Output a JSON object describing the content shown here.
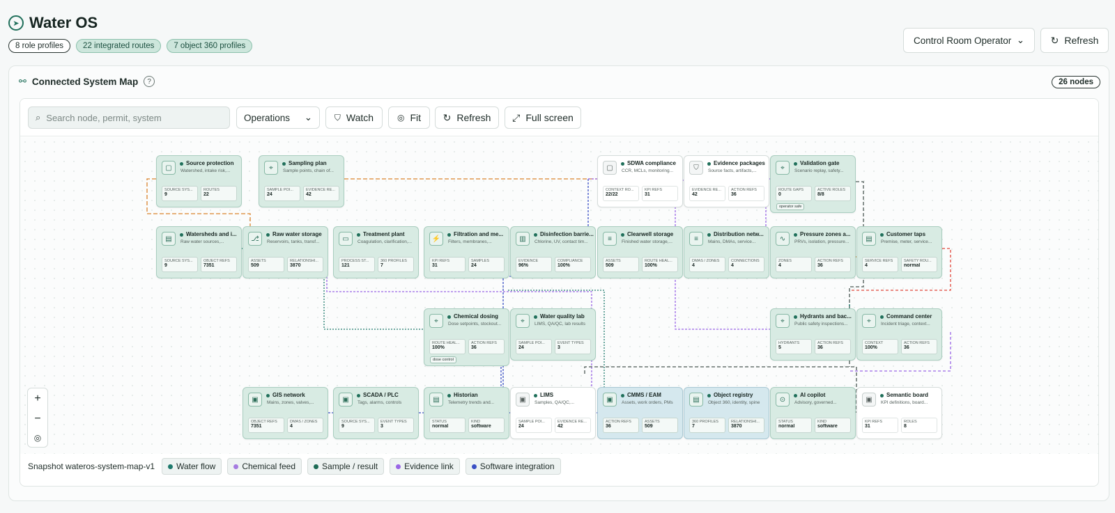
{
  "header": {
    "title": "Water OS",
    "badges": [
      "8 role profiles",
      "22 integrated routes",
      "7 object 360 profiles"
    ],
    "role_select": "Control Room Operator",
    "refresh_label": "Refresh"
  },
  "panel": {
    "title": "Connected System Map",
    "node_count": "26 nodes"
  },
  "toolbar": {
    "search_placeholder": "Search node, permit, system",
    "mode": "Operations",
    "watch": "Watch",
    "fit": "Fit",
    "refresh": "Refresh",
    "fullscreen": "Full screen"
  },
  "nodes": [
    {
      "title": "Source protection",
      "sub": "Watershed, intake risk,...",
      "s1l": "SOURCE SYS...",
      "s1v": "9",
      "s2l": "ROUTES",
      "s2v": "22"
    },
    {
      "title": "Sampling plan",
      "sub": "Sample points, chain of...",
      "s1l": "SAMPLE POI...",
      "s1v": "24",
      "s2l": "EVIDENCE RE...",
      "s2v": "42"
    },
    {
      "title": "SDWA compliance",
      "sub": "CCR, MCLs, monitoring...",
      "s1l": "CONTEXT RO...",
      "s1v": "22/22",
      "s2l": "KPI REFS",
      "s2v": "31"
    },
    {
      "title": "Evidence packages",
      "sub": "Source facts, artifacts,...",
      "s1l": "EVIDENCE RE...",
      "s1v": "42",
      "s2l": "ACTION REFS",
      "s2v": "36"
    },
    {
      "title": "Validation gate",
      "sub": "Scenario replay, safety...",
      "s1l": "ROUTE GAPS",
      "s1v": "0",
      "s2l": "ACTIVE ROLES",
      "s2v": "8/8",
      "chip": "operator safe"
    },
    {
      "title": "Watersheds and i...",
      "sub": "Raw water sources,...",
      "s1l": "SOURCE SYS...",
      "s1v": "9",
      "s2l": "OBJECT REFS",
      "s2v": "7351"
    },
    {
      "title": "Raw water storage",
      "sub": "Reservoirs, tanks, transf...",
      "s1l": "ASSETS",
      "s1v": "509",
      "s2l": "RELATIONSHI...",
      "s2v": "3870"
    },
    {
      "title": "Treatment plant",
      "sub": "Coagulation, clarification,...",
      "s1l": "PROCESS ST...",
      "s1v": "121",
      "s2l": "360 PROFILES",
      "s2v": "7"
    },
    {
      "title": "Filtration and me...",
      "sub": "Filters, membranes,...",
      "s1l": "KPI REFS",
      "s1v": "31",
      "s2l": "SAMPLES",
      "s2v": "24"
    },
    {
      "title": "Disinfection barrie...",
      "sub": "Chlorine, UV, contact tim...",
      "s1l": "EVIDENCE",
      "s1v": "96%",
      "s2l": "COMPLIANCE",
      "s2v": "100%"
    },
    {
      "title": "Clearwell storage",
      "sub": "Finished water storage,...",
      "s1l": "ASSETS",
      "s1v": "509",
      "s2l": "ROUTE HEAL...",
      "s2v": "100%"
    },
    {
      "title": "Distribution netw...",
      "sub": "Mains, DMAs, service...",
      "s1l": "DMAS / ZONES",
      "s1v": "4",
      "s2l": "CONNECTIONS",
      "s2v": "4"
    },
    {
      "title": "Pressure zones a...",
      "sub": "PRVs, isolation, pressure...",
      "s1l": "ZONES",
      "s1v": "4",
      "s2l": "ACTION REFS",
      "s2v": "36"
    },
    {
      "title": "Customer taps",
      "sub": "Premise, meter, service...",
      "s1l": "SERVICE REFS",
      "s1v": "4",
      "s2l": "SAFETY ROU...",
      "s2v": "normal"
    },
    {
      "title": "Chemical dosing",
      "sub": "Dose setpoints, stockout...",
      "s1l": "ROUTE HEAL...",
      "s1v": "100%",
      "s2l": "ACTION REFS",
      "s2v": "36",
      "chip": "dose control"
    },
    {
      "title": "Water quality lab",
      "sub": "LIMS, QA/QC, lab results",
      "s1l": "SAMPLE POI...",
      "s1v": "24",
      "s2l": "EVENT TYPES",
      "s2v": "3"
    },
    {
      "title": "Hydrants and bac...",
      "sub": "Public safety inspections...",
      "s1l": "HYDRANTS",
      "s1v": "5",
      "s2l": "ACTION REFS",
      "s2v": "36"
    },
    {
      "title": "Command center",
      "sub": "Incident triage, context...",
      "s1l": "CONTEXT",
      "s1v": "100%",
      "s2l": "ACTION REFS",
      "s2v": "36"
    },
    {
      "title": "GIS network",
      "sub": "Mains, zones, valves,...",
      "s1l": "OBJECT REFS",
      "s1v": "7351",
      "s2l": "DMAS / ZONES",
      "s2v": "4"
    },
    {
      "title": "SCADA / PLC",
      "sub": "Tags, alarms, controls",
      "s1l": "SOURCE SYS...",
      "s1v": "9",
      "s2l": "EVENT TYPES",
      "s2v": "3"
    },
    {
      "title": "Historian",
      "sub": "Telemetry trends and...",
      "s1l": "STATUS",
      "s1v": "normal",
      "s2l": "KIND",
      "s2v": "software"
    },
    {
      "title": "LIMS",
      "sub": "Samples, QA/QC,...",
      "s1l": "SAMPLE POI...",
      "s1v": "24",
      "s2l": "EVIDENCE RE...",
      "s2v": "42"
    },
    {
      "title": "CMMS / EAM",
      "sub": "Assets, work orders, PMs",
      "s1l": "ACTION REFS",
      "s1v": "36",
      "s2l": "ASSETS",
      "s2v": "509"
    },
    {
      "title": "Object registry",
      "sub": "Object 360, identity, spine",
      "s1l": "360 PROFILES",
      "s1v": "7",
      "s2l": "RELATIONSHI...",
      "s2v": "3870"
    },
    {
      "title": "AI copilot",
      "sub": "Advisory, governed...",
      "s1l": "STATUS",
      "s1v": "normal",
      "s2l": "KIND",
      "s2v": "software"
    },
    {
      "title": "Semantic board",
      "sub": "KPI definitions, board...",
      "s1l": "KPI REFS",
      "s1v": "31",
      "s2l": "ROLES",
      "s2v": "8"
    }
  ],
  "legend": {
    "snapshot": "Snapshot wateros-system-map-v1",
    "items": [
      {
        "label": "Water flow",
        "color": "#1f7a6d"
      },
      {
        "label": "Chemical feed",
        "color": "#a57be0"
      },
      {
        "label": "Sample / result",
        "color": "#1d6b55"
      },
      {
        "label": "Evidence link",
        "color": "#9a66e6"
      },
      {
        "label": "Software integration",
        "color": "#3a4fc4"
      }
    ]
  },
  "colors": {
    "accent": "#1f6f5a",
    "node_fill": "#d8ebe3"
  }
}
